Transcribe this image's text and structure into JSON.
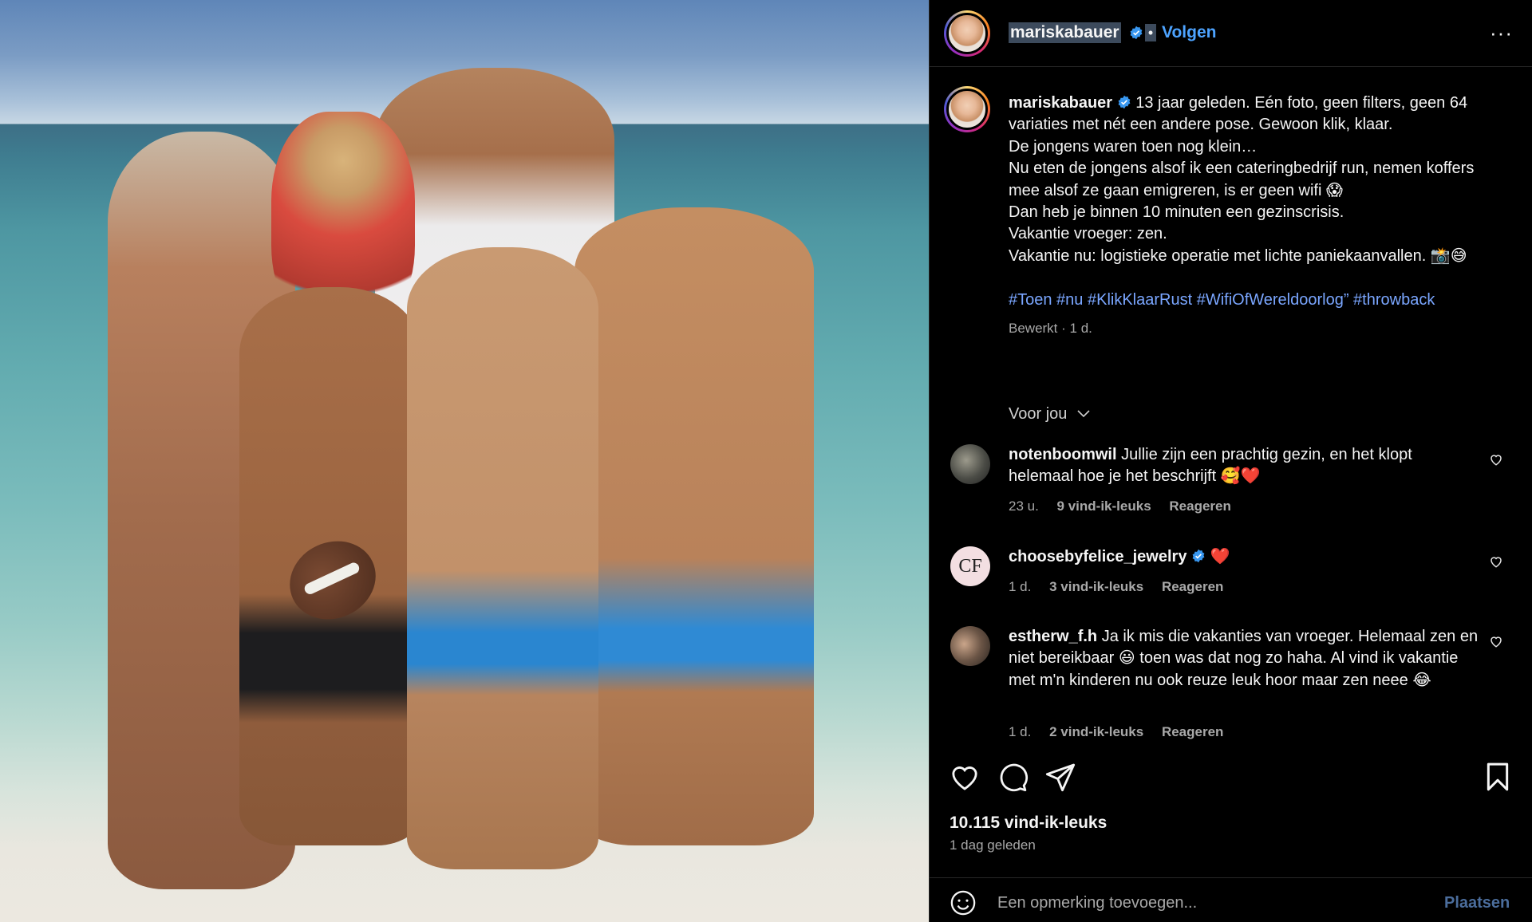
{
  "post": {
    "username": "mariskabauer",
    "separator": "•",
    "follow_label": "Volgen",
    "more_label": "···"
  },
  "caption": {
    "username": "mariskabauer",
    "lines": [
      "13 jaar geleden. Eén foto, geen filters, geen 64 variaties met nét een andere pose. Gewoon klik, klaar.",
      "De jongens waren toen nog klein…",
      "Nu eten de jongens alsof ik een cateringbedrijf run, nemen koffers mee alsof ze gaan emigreren, is er geen wifi 😱",
      "Dan heb je binnen 10 minuten een gezinscrisis.",
      "Vakantie vroeger: zen.",
      "Vakantie nu: logistieke operatie met lichte paniekaanvallen. 📸😅"
    ],
    "hashtags": "#Toen #nu #KlikKlaarRust #WifiOfWereldoorlog” #throwback",
    "meta": "Bewerkt · 1 d."
  },
  "voor_jou": "Voor jou",
  "comments": [
    {
      "username": "notenboomwil",
      "text": "Jullie zijn een prachtig gezin, en het klopt helemaal hoe je het beschrijft 🥰❤️",
      "time": "23 u.",
      "likes": "9 vind-ik-leuks",
      "reply": "Reageren"
    },
    {
      "username": "choosebyfelice_jewelry",
      "text": "❤️",
      "time": "1 d.",
      "likes": "3 vind-ik-leuks",
      "reply": "Reageren",
      "avatar_letters": "CF"
    },
    {
      "username": "estherw_f.h",
      "text": "Ja ik mis die vakanties van vroeger. Helemaal zen en niet bereikbaar 😃 toen was dat nog zo haha. Al vind ik vakantie met m'n kinderen nu ook reuze leuk hoor maar zen neee 😂",
      "time": "1 d.",
      "likes": "2 vind-ik-leuks",
      "reply": "Reageren"
    }
  ],
  "likes_count": "10.115 vind-ik-leuks",
  "posted_ago": "1 dag geleden",
  "add_comment": {
    "placeholder": "Een opmerking toevoegen...",
    "post_label": "Plaatsen"
  },
  "colors": {
    "background": "#000000",
    "link": "#4da3ff",
    "hashtag": "#7aa6ff",
    "muted": "#a8a8a8",
    "verified": "#3897f0"
  }
}
